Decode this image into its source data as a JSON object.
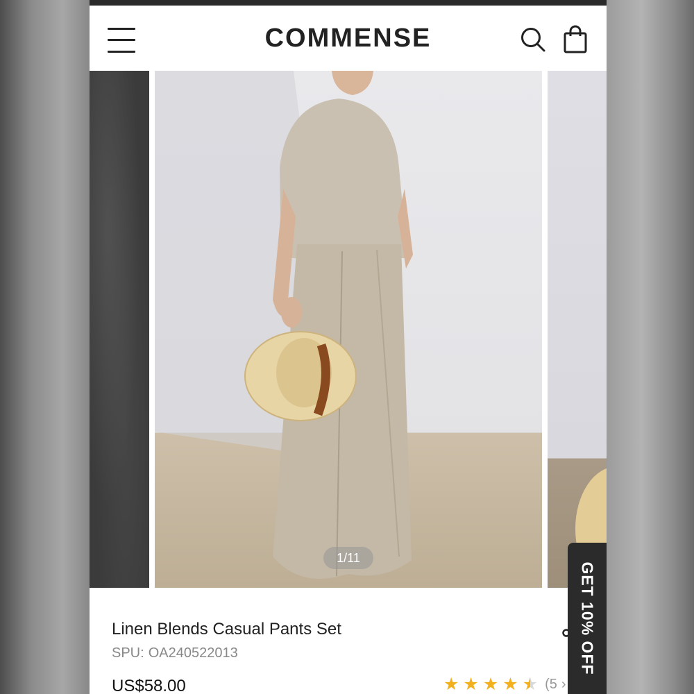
{
  "header": {
    "brand": "COMMENSE",
    "menu_icon": "hamburger-menu-icon",
    "search_icon": "search-icon",
    "bag_icon": "shopping-bag-icon"
  },
  "gallery": {
    "counter": "1/11",
    "current_index": 1,
    "total_images": 11
  },
  "product": {
    "title": "Linen Blends Casual Pants Set",
    "spu_label": "SPU:",
    "spu_value": "OA240522013",
    "price": "US$58.00",
    "rating": 4.5,
    "review_count": "(5",
    "share_icon": "share-icon"
  },
  "promo": {
    "label": "GET 10% OFF"
  },
  "colors": {
    "text": "#222222",
    "muted": "#888888",
    "star": "#f2b01e",
    "promo_bg": "#2b2b2b"
  }
}
